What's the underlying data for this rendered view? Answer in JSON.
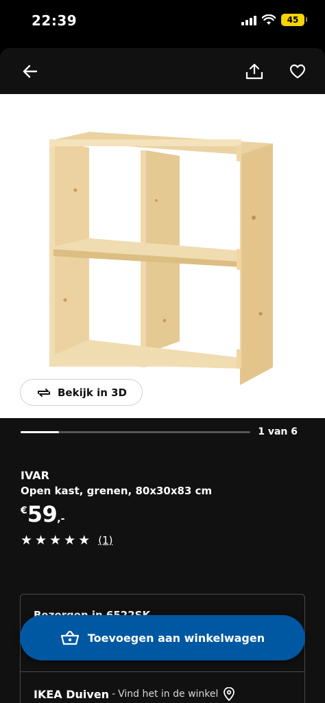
{
  "status_bar": {
    "time": "22:39",
    "battery": "45"
  },
  "header": {
    "back_icon": "arrow-left-icon",
    "share_icon": "share-icon",
    "favorite_icon": "heart-icon"
  },
  "image": {
    "view_3d_label": "Bekijk in 3D"
  },
  "carousel": {
    "counter": "1 van 6",
    "progress": 0.167
  },
  "product": {
    "brand": "IVAR",
    "description": "Open kast, grenen, 80x30x83 cm",
    "price_currency": "€",
    "price_amount": "59",
    "price_decimals": ",-",
    "rating": 5,
    "review_count": "(1)"
  },
  "delivery": {
    "text": "Bezorgen in 6522SK"
  },
  "store": {
    "name": "IKEA Duiven",
    "separator": "-",
    "link": "Vind het in de winkel"
  },
  "cart_button": {
    "label": "Toevoegen aan winkelwagen"
  },
  "colors": {
    "accent_blue": "#0058a3",
    "background": "#111111",
    "battery": "#f5d400"
  }
}
